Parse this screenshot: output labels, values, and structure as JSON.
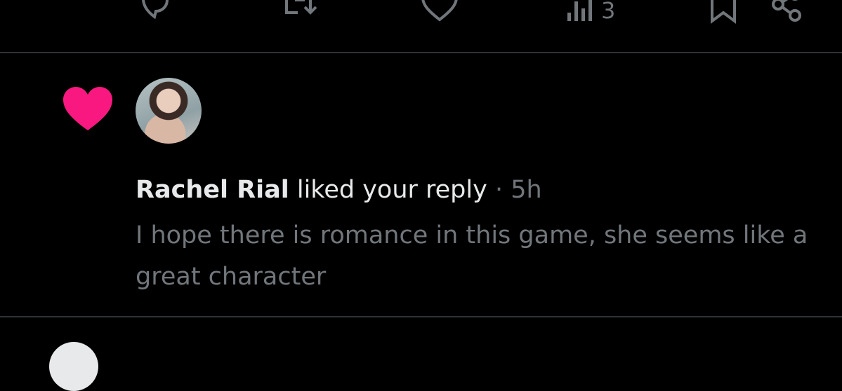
{
  "action_bar": {
    "views_count": "3"
  },
  "notification": {
    "user_name": "Rachel Rial",
    "action_text": "liked your reply",
    "separator": "·",
    "timestamp": "5h",
    "reply_text": "I hope there is romance in this game, she seems like a great character",
    "heart_color": "#f91880"
  },
  "icons": [
    "reply-icon",
    "retweet-icon",
    "like-icon",
    "views-icon",
    "bookmark-icon",
    "share-icon",
    "heart-icon"
  ]
}
